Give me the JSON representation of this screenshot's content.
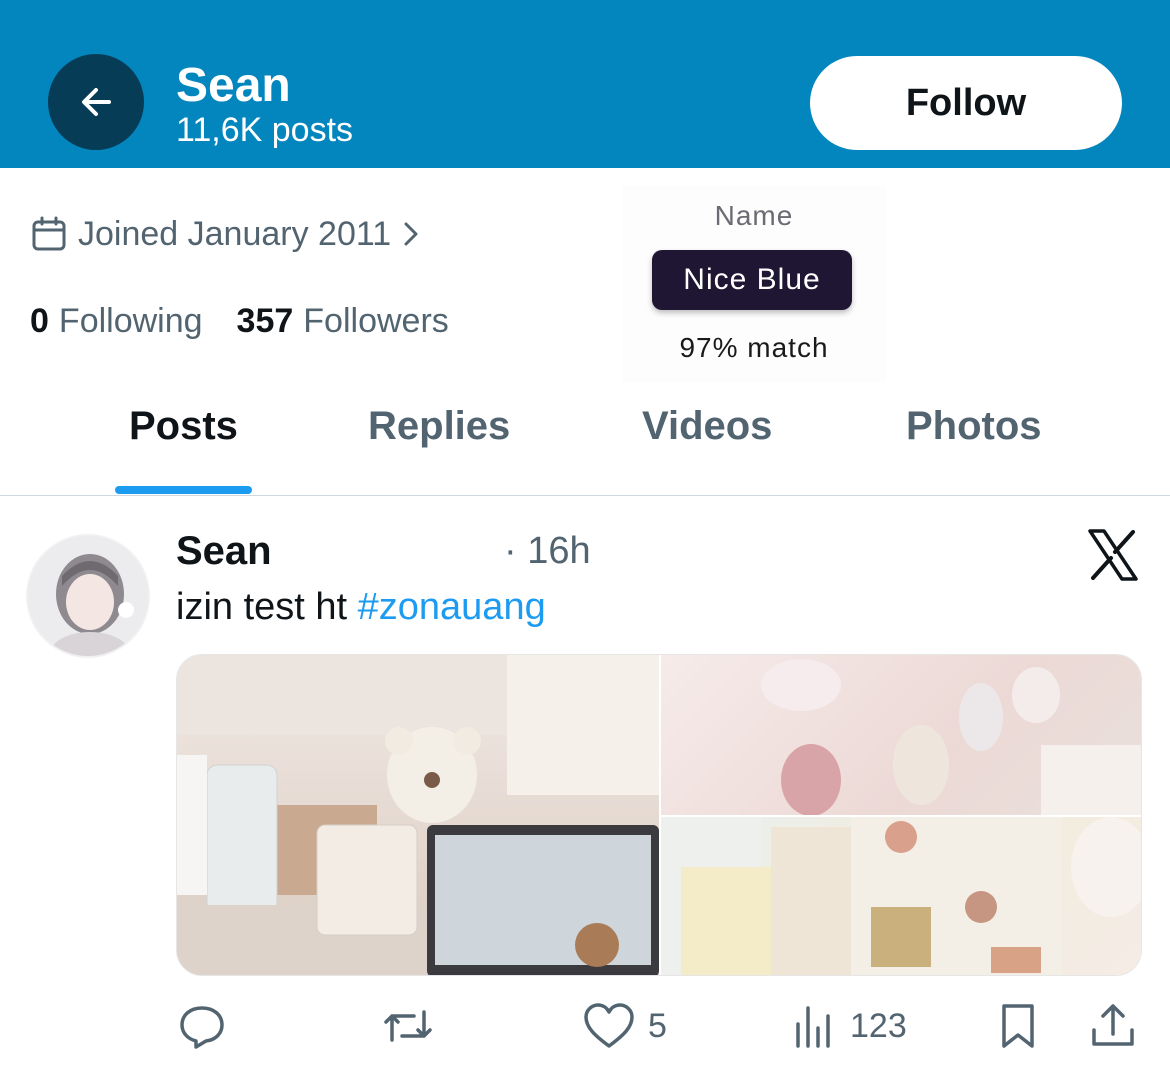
{
  "header": {
    "name": "Sean",
    "posts_count": "11,6K posts",
    "follow_label": "Follow",
    "bg_color": "#0385bd"
  },
  "profile": {
    "joined": "Joined January 2011",
    "following_count": "0",
    "following_label": "Following",
    "followers_count": "357",
    "followers_label": "Followers"
  },
  "sticker": {
    "caption": "Name",
    "value": "Nice Blue",
    "match": "97% match"
  },
  "tabs": [
    {
      "label": "Posts",
      "active": true
    },
    {
      "label": "Replies",
      "active": false
    },
    {
      "label": "Videos",
      "active": false
    },
    {
      "label": "Photos",
      "active": false
    }
  ],
  "post": {
    "author": "Sean",
    "time": "· 16h",
    "text": "izin test ht ",
    "hashtag": "#zonauang",
    "actions": {
      "reply_count": "",
      "repost_count": "",
      "like_count": "5",
      "views_count": "123"
    }
  },
  "icons": [
    "back-arrow-icon",
    "calendar-icon",
    "chevron-right-icon",
    "x-logo-icon",
    "reply-icon",
    "repost-icon",
    "like-icon",
    "views-icon",
    "bookmark-icon",
    "share-icon"
  ],
  "colors": {
    "accent": "#1d9bf0",
    "muted": "#536471",
    "text": "#0f1419"
  }
}
